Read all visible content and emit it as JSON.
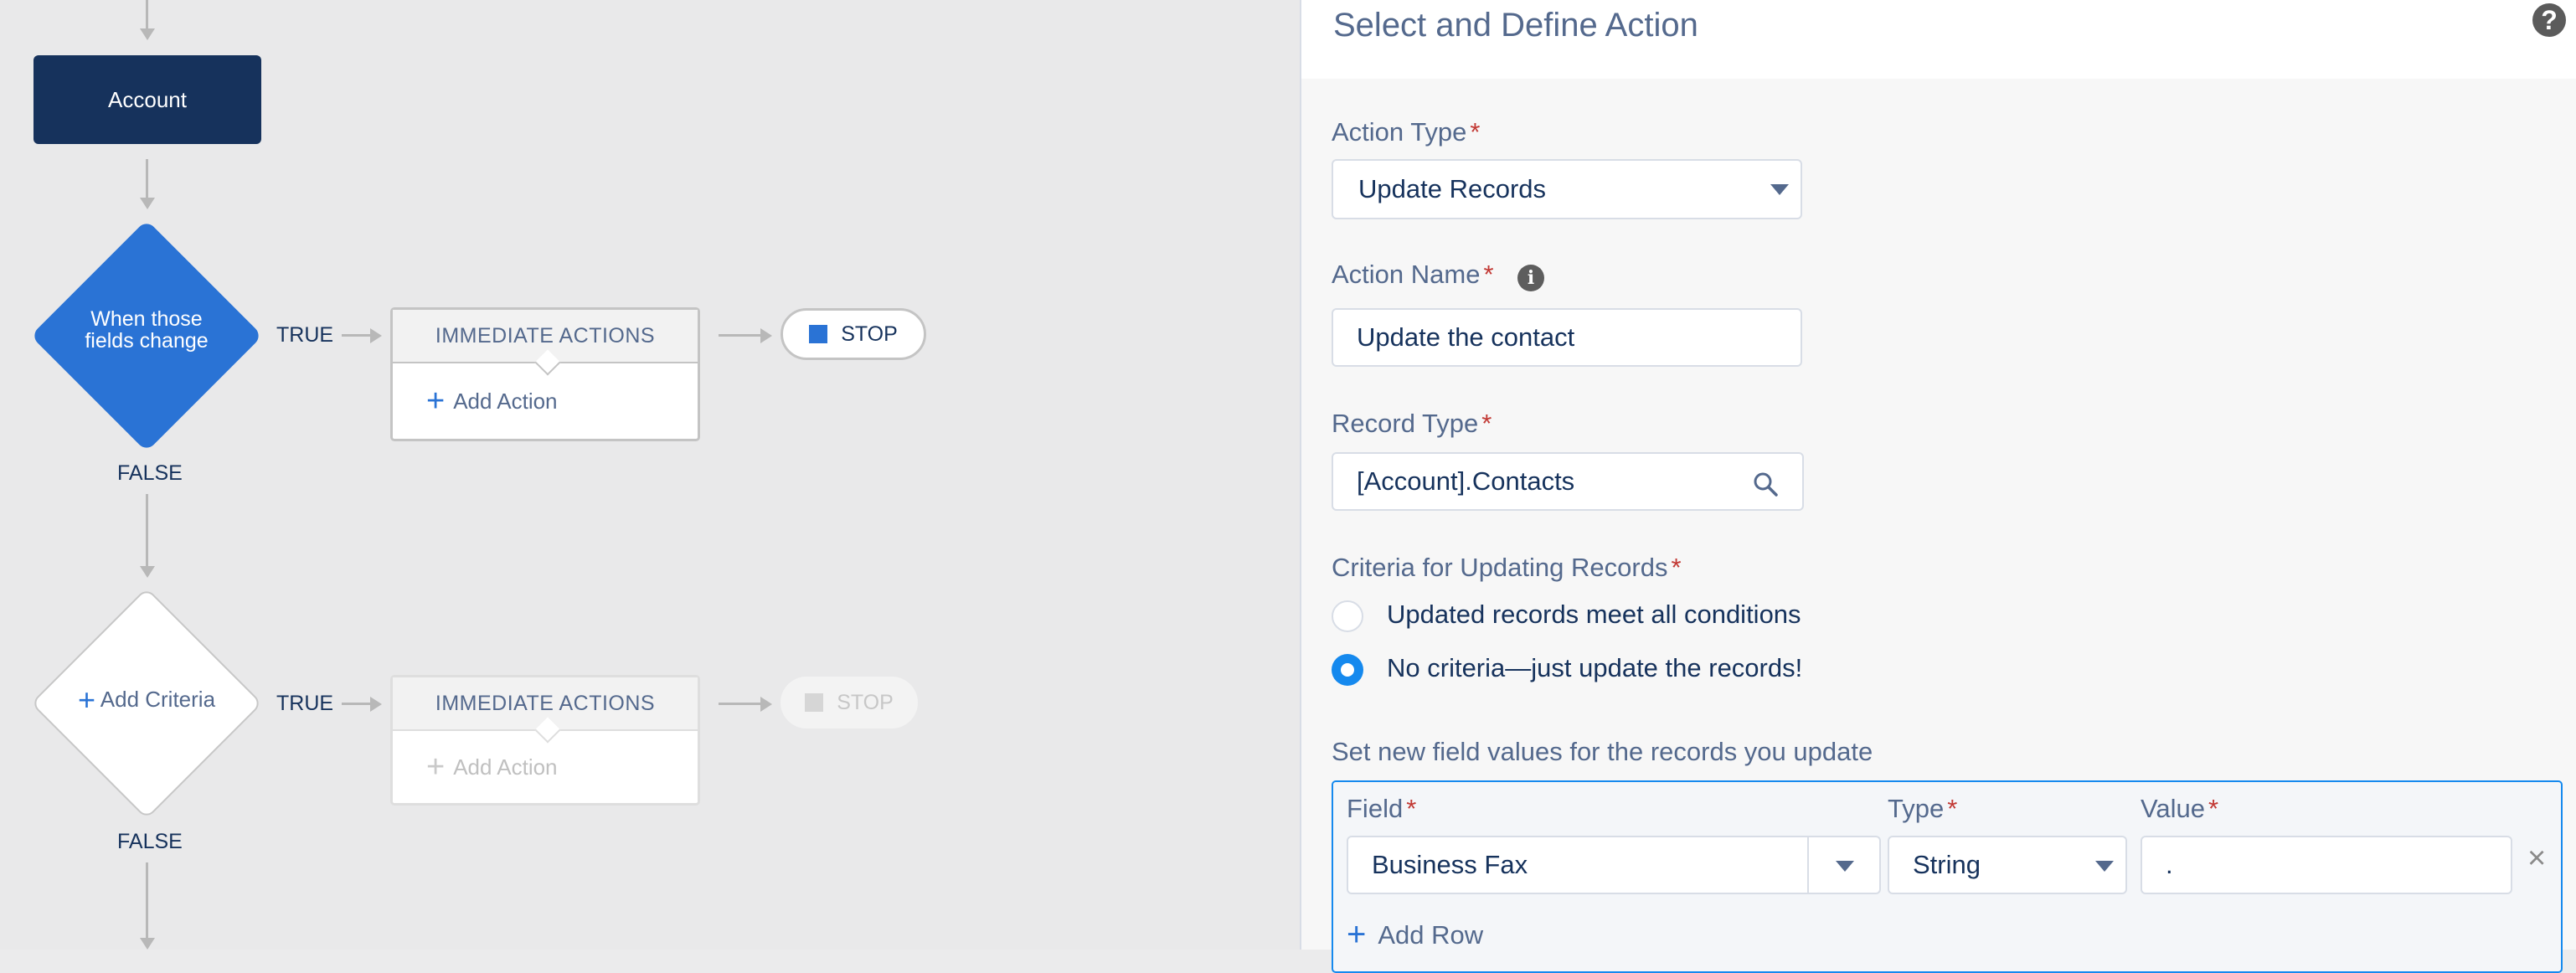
{
  "flow": {
    "object_node": "Account",
    "criteria_1": {
      "label_line1": "When those",
      "label_line2": "fields change",
      "true_label": "TRUE",
      "false_label": "FALSE"
    },
    "criteria_2": {
      "label": "Add Criteria",
      "true_label": "TRUE",
      "false_label": "FALSE"
    },
    "immediate_actions_1": {
      "header": "IMMEDIATE ACTIONS",
      "add_action": "Add Action"
    },
    "immediate_actions_2": {
      "header": "IMMEDIATE ACTIONS",
      "add_action": "Add Action"
    },
    "stop_1": "STOP",
    "stop_2": "STOP"
  },
  "panel": {
    "title": "Select and Define Action",
    "help_icon": "?",
    "action_type": {
      "label": "Action Type",
      "value": "Update Records"
    },
    "action_name": {
      "label": "Action Name",
      "value": "Update the contact",
      "info_icon": "i"
    },
    "record_type": {
      "label": "Record Type",
      "value": "[Account].Contacts"
    },
    "criteria": {
      "label": "Criteria for Updating Records",
      "options": [
        "Updated records meet all conditions",
        "No criteria—just update the records!"
      ],
      "selected_index": 1
    },
    "field_values": {
      "label": "Set new field values for the records you update",
      "columns": {
        "field": "Field",
        "type": "Type",
        "value": "Value"
      },
      "rows": [
        {
          "field": "Business Fax",
          "type": "String",
          "value": "."
        }
      ],
      "add_row": "Add Row"
    }
  },
  "colors": {
    "primary": "#2a73d5",
    "dark": "#16325c",
    "required": "#c23934"
  }
}
